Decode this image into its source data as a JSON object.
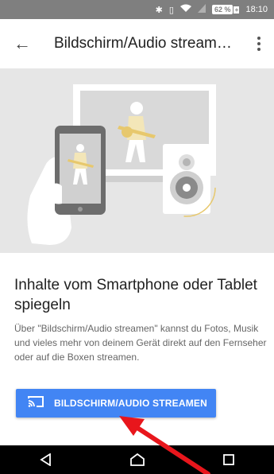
{
  "status_bar": {
    "battery_percent": "62 %",
    "time": "18:10",
    "icons": [
      "bluetooth-icon",
      "vibrate-icon",
      "wifi-icon",
      "signal-icon",
      "battery-charging-icon"
    ]
  },
  "app_bar": {
    "title": "Bildschirm/Audio stream…",
    "back_icon": "arrow-left-icon",
    "menu_icon": "more-vert-icon"
  },
  "content": {
    "heading": "Inhalte vom Smartphone oder Tablet spiegeln",
    "body": "Über \"Bildschirm/Audio streamen\" kannst du Fotos, Musik und vieles mehr von deinem Gerät direkt auf den Fernseher oder auf die Boxen streamen."
  },
  "cast_button": {
    "icon": "cast-icon",
    "label": "BILDSCHIRM/AUDIO STREAMEN"
  },
  "nav_bar": {
    "icons": [
      "back-triangle-icon",
      "home-icon",
      "recents-icon"
    ]
  },
  "colors": {
    "accent": "#4285f4",
    "annotation_arrow": "#e8161c",
    "hero_bg": "#e6e6e6",
    "status_bar_bg": "#7f7f7f"
  }
}
